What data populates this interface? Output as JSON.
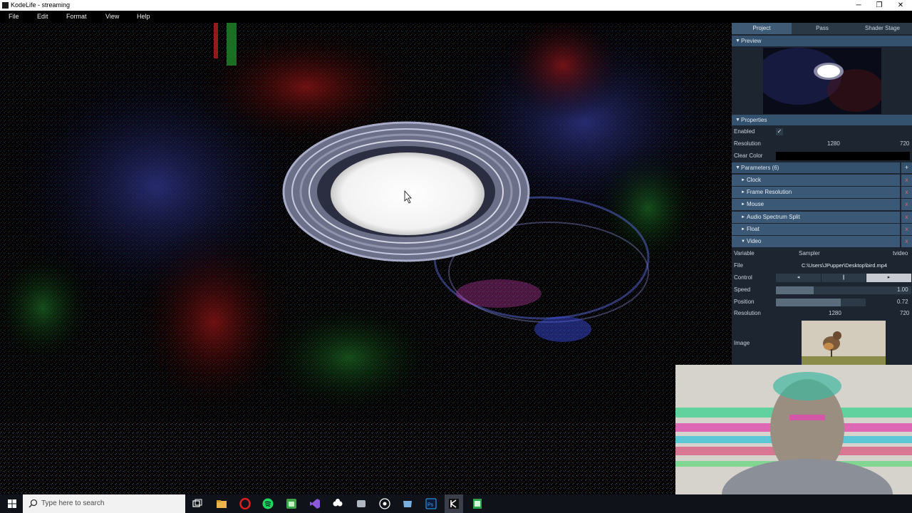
{
  "window": {
    "title": "KodeLife - streaming",
    "minimize_glyph": "─",
    "maximize_glyph": "❐",
    "close_glyph": "✕"
  },
  "menu": [
    "File",
    "Edit",
    "Format",
    "View",
    "Help"
  ],
  "panel": {
    "tabs": [
      "Project",
      "Pass",
      "Shader Stage"
    ],
    "active_tab": 0,
    "preview_label": "Preview",
    "properties_label": "Properties",
    "enabled_label": "Enabled",
    "enabled_check": "✓",
    "resolution_label": "Resolution",
    "resolution_w": "1280",
    "resolution_h": "720",
    "clear_color_label": "Clear Color",
    "parameters_label": "Parameters (6)",
    "add_glyph": "+",
    "parameters": [
      "Clock",
      "Frame Resolution",
      "Mouse",
      "Audio Spectrum Split",
      "Float",
      "Video"
    ],
    "remove_glyph": "x",
    "video": {
      "variable_label": "Variable",
      "variable_type": "Sampler",
      "variable_name": "tvideo",
      "file_label": "File",
      "file_value": "C:\\Users\\JPupper\\Desktop\\bird.mp4",
      "control_label": "Control",
      "play_back_glyph": "◂",
      "pause_glyph": "❙",
      "play_glyph": "▸",
      "speed_label": "Speed",
      "speed_value": "1.00",
      "speed_fraction": 0.28,
      "position_label": "Position",
      "position_value": "0.72",
      "position_fraction": 0.72,
      "resolution_label": "Resolution",
      "resolution_w": "1280",
      "resolution_h": "720",
      "image_label": "Image"
    }
  },
  "taskbar": {
    "search_placeholder": "Type here to search",
    "icons": [
      "windows-start-icon",
      "search-icon",
      "task-view-icon",
      "file-explorer-icon",
      "opera-icon",
      "spotify-icon",
      "android-icon",
      "visual-studio-icon",
      "obs-icon",
      "app-icon",
      "obs-studio-icon",
      "folder-icon",
      "photoshop-icon",
      "kodelife-icon",
      "spreadsheet-icon"
    ]
  },
  "colors": {
    "panel_bg": "#1d2630",
    "section_header": "#34516e",
    "param_row": "#3b5976",
    "remove_x": "#e06a6a"
  }
}
